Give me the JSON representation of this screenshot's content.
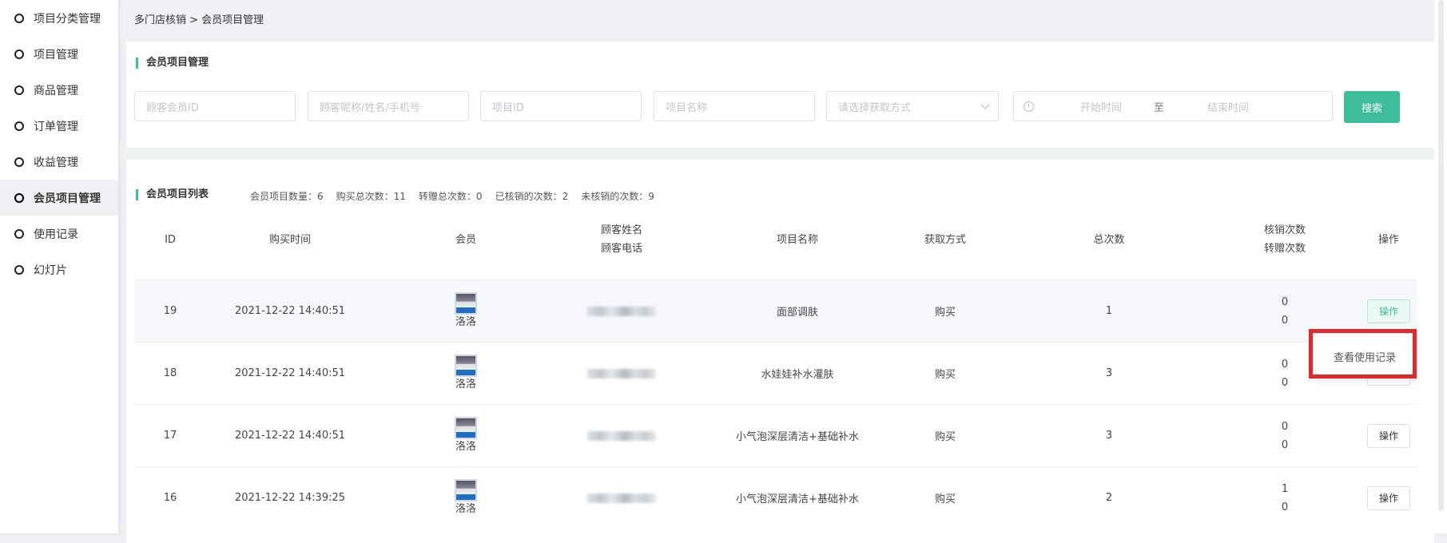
{
  "sidebar": {
    "items": [
      {
        "label": "项目分类管理"
      },
      {
        "label": "项目管理"
      },
      {
        "label": "商品管理"
      },
      {
        "label": "订单管理"
      },
      {
        "label": "收益管理"
      },
      {
        "label": "会员项目管理"
      },
      {
        "label": "使用记录"
      },
      {
        "label": "幻灯片"
      }
    ],
    "active_index": 5
  },
  "breadcrumb": "多门店核销 > 会员项目管理",
  "filter": {
    "title": "会员项目管理",
    "member_id_placeholder": "顾客会员ID",
    "name_phone_placeholder": "顾客昵称/姓名/手机号",
    "project_id_placeholder": "项目ID",
    "project_name_placeholder": "项目名称",
    "acquire_select_placeholder": "请选择获取方式",
    "start_time_placeholder": "开始时间",
    "range_separator": "至",
    "end_time_placeholder": "结束时间",
    "search_label": "搜索"
  },
  "list": {
    "title": "会员项目列表",
    "stats": {
      "count": "会员项目数量：6",
      "buy_total": "购买总次数：11",
      "transfer_total": "转赠总次数：0",
      "verified": "已核销的次数：2",
      "unverified": "未核销的次数：9"
    },
    "headers": {
      "id": "ID",
      "buy_time": "购买时间",
      "member": "会员",
      "customer_name": "顾客姓名",
      "customer_phone": "顾客电话",
      "project_name": "项目名称",
      "acquire": "获取方式",
      "total": "总次数",
      "verify_count": "核销次数",
      "transfer_count": "转赠次数",
      "op": "操作"
    },
    "rows": [
      {
        "id": "19",
        "time": "2021-12-22 14:40:51",
        "member": "洛洛",
        "project": "面部调肤",
        "acquire": "购买",
        "total": "1",
        "verify": "0",
        "transfer": "0",
        "op": "操作"
      },
      {
        "id": "18",
        "time": "2021-12-22 14:40:51",
        "member": "洛洛",
        "project": "水娃娃补水灌肤",
        "acquire": "购买",
        "total": "3",
        "verify": "0",
        "transfer": "0",
        "op": "操作"
      },
      {
        "id": "17",
        "time": "2021-12-22 14:40:51",
        "member": "洛洛",
        "project": "小气泡深层清洁+基础补水",
        "acquire": "购买",
        "total": "3",
        "verify": "0",
        "transfer": "0",
        "op": "操作"
      },
      {
        "id": "16",
        "time": "2021-12-22 14:39:25",
        "member": "洛洛",
        "project": "小气泡深层清洁+基础补水",
        "acquire": "购买",
        "total": "2",
        "verify": "1",
        "transfer": "0",
        "op": "操作"
      }
    ],
    "dropdown_item": "查看使用记录"
  },
  "colors": {
    "accent": "#3dbd9a",
    "highlight": "#e02a2a"
  }
}
